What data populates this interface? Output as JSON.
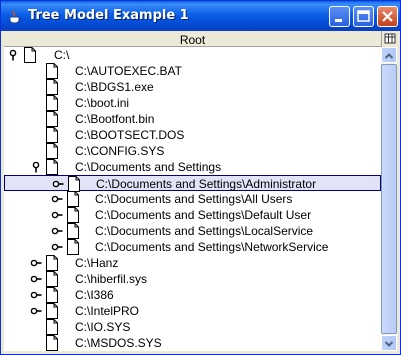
{
  "window": {
    "title": "Tree Model Example 1",
    "buttons": {
      "minimize": "minimize-icon",
      "maximize": "maximize-icon",
      "close": "close-icon"
    }
  },
  "table": {
    "column_header": "Root",
    "corner_icon": "column-chooser-icon"
  },
  "tree": {
    "nodes": [
      {
        "label": "C:\\",
        "level": 0,
        "handle": "expanded",
        "selected": false
      },
      {
        "label": "C:\\AUTOEXEC.BAT",
        "level": 1,
        "handle": "none",
        "selected": false
      },
      {
        "label": "C:\\BDGS1.exe",
        "level": 1,
        "handle": "none",
        "selected": false
      },
      {
        "label": "C:\\boot.ini",
        "level": 1,
        "handle": "none",
        "selected": false
      },
      {
        "label": "C:\\Bootfont.bin",
        "level": 1,
        "handle": "none",
        "selected": false
      },
      {
        "label": "C:\\BOOTSECT.DOS",
        "level": 1,
        "handle": "none",
        "selected": false
      },
      {
        "label": "C:\\CONFIG.SYS",
        "level": 1,
        "handle": "none",
        "selected": false
      },
      {
        "label": "C:\\Documents and Settings",
        "level": 1,
        "handle": "expanded",
        "selected": false
      },
      {
        "label": "C:\\Documents and Settings\\Administrator",
        "level": 2,
        "handle": "collapsed",
        "selected": true
      },
      {
        "label": "C:\\Documents and Settings\\All Users",
        "level": 2,
        "handle": "collapsed",
        "selected": false
      },
      {
        "label": "C:\\Documents and Settings\\Default User",
        "level": 2,
        "handle": "collapsed",
        "selected": false
      },
      {
        "label": "C:\\Documents and Settings\\LocalService",
        "level": 2,
        "handle": "collapsed",
        "selected": false
      },
      {
        "label": "C:\\Documents and Settings\\NetworkService",
        "level": 2,
        "handle": "collapsed",
        "selected": false
      },
      {
        "label": "C:\\Hanz",
        "level": 1,
        "handle": "collapsed",
        "selected": false
      },
      {
        "label": "C:\\hiberfil.sys",
        "level": 1,
        "handle": "collapsed",
        "selected": false
      },
      {
        "label": "C:\\I386",
        "level": 1,
        "handle": "collapsed",
        "selected": false
      },
      {
        "label": "C:\\IntelPRO",
        "level": 1,
        "handle": "collapsed",
        "selected": false
      },
      {
        "label": "C:\\IO.SYS",
        "level": 1,
        "handle": "none",
        "selected": false
      },
      {
        "label": "C:\\MSDOS.SYS",
        "level": 1,
        "handle": "none",
        "selected": false
      }
    ]
  },
  "colors": {
    "title_bar": "#0054e3",
    "selection_bg": "#e3e3f8",
    "selection_border": "#000080"
  }
}
